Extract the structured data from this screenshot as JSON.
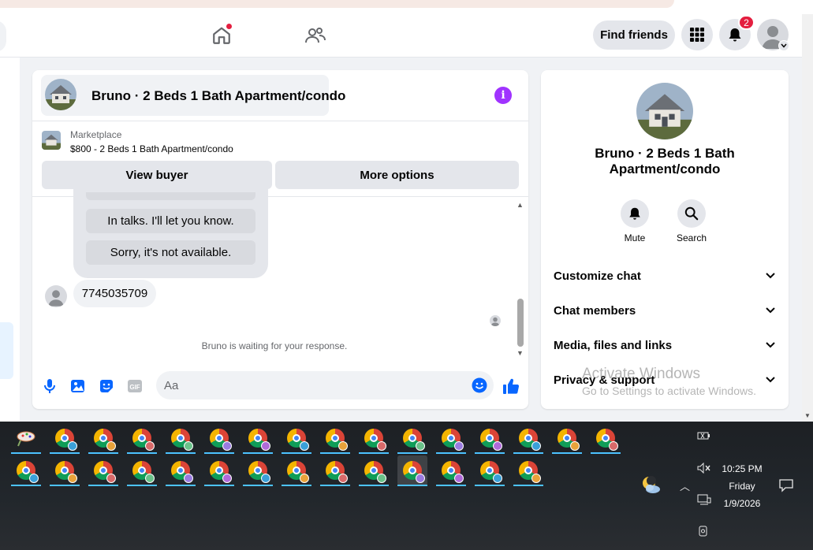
{
  "header": {
    "find_friends": "Find friends",
    "notification_count": "2"
  },
  "chat": {
    "title": "Bruno · 2 Beds 1 Bath Apartment/condo",
    "marketplace_label": "Marketplace",
    "listing": "$800 - 2 Beds 1 Bath Apartment/condo",
    "view_buyer": "View buyer",
    "more_options": "More options",
    "quick_replies": [
      "In talks. I'll let you know.",
      "Sorry, it's not available."
    ],
    "received_message": "7745035709",
    "status": "Bruno is waiting for your response.",
    "input_placeholder": "Aa"
  },
  "info_panel": {
    "name": "Bruno · 2 Beds 1 Bath Apartment/condo",
    "actions": [
      {
        "label": "Mute",
        "icon": "bell-icon"
      },
      {
        "label": "Search",
        "icon": "search-icon"
      }
    ],
    "sections": [
      "Customize chat",
      "Chat members",
      "Media, files and links",
      "Privacy & support"
    ]
  },
  "watermark": {
    "line1": "Activate Windows",
    "line2": "Go to Settings to activate Windows."
  },
  "taskbar": {
    "time": "10:25 PM",
    "day": "Friday",
    "date": "1/9/2026"
  },
  "colors": {
    "accent": "#0866ff",
    "info": "#a033ff",
    "badge": "#e41e3f",
    "taskbar_underline": "#4cc2ff"
  }
}
